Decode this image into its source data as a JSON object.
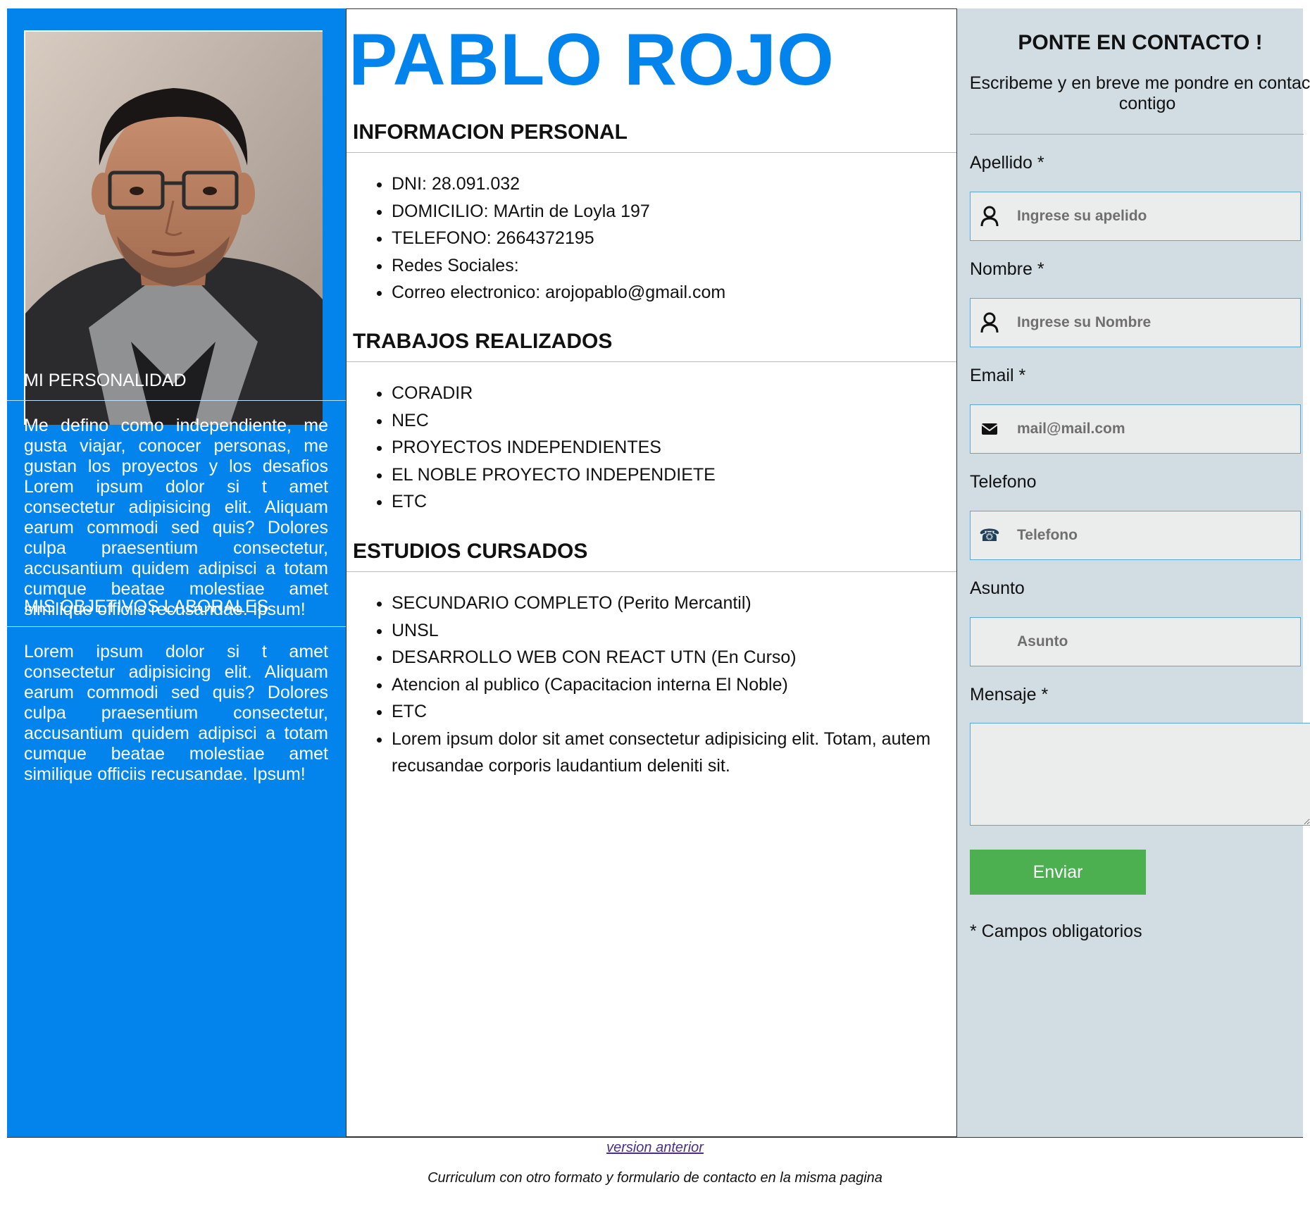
{
  "profile": {
    "photo_alt": "",
    "personality_heading": "MI PERSONALIDAD",
    "personality_text": "Me defino como independiente, me gusta viajar, conocer personas, me gustan los proyectos y los desafios Lorem ipsum dolor si t amet consectetur adipisicing elit. Aliquam earum commodi sed quis? Dolores culpa praesentium consectetur, accusantium quidem adipisci a totam cumque beatae molestiae amet similique officiis recusandae. Ipsum!",
    "objectives_heading": "MIS OBJETIVOS LABORALES",
    "objectives_text": "Lorem ipsum dolor si t amet consectetur adipisicing elit. Aliquam earum commodi sed quis? Dolores culpa praesentium consectetur, accusantium quidem adipisci a totam cumque beatae molestiae amet similique officiis recusandae. Ipsum!"
  },
  "main": {
    "name": "PABLO ROJO",
    "personal_info": {
      "title": "INFORMACION PERSONAL",
      "items": [
        "DNI: 28.091.032",
        "DOMICILIO: MArtin de Loyla 197",
        "TELEFONO: 2664372195",
        "Redes Sociales:",
        "Correo electronico: arojopablo@gmail.com"
      ]
    },
    "jobs": {
      "title": "TRABAJOS REALIZADOS",
      "items": [
        "CORADIR",
        "NEC",
        "PROYECTOS INDEPENDIENTES",
        "EL NOBLE PROYECTO INDEPENDIETE",
        "ETC"
      ]
    },
    "studies": {
      "title": "ESTUDIOS CURSADOS",
      "items": [
        "SECUNDARIO COMPLETO (Perito Mercantil)",
        "UNSL",
        "DESARROLLO WEB CON REACT UTN (En Curso)",
        "Atencion al publico (Capacitacion interna El Noble)",
        "ETC",
        "Lorem ipsum dolor sit amet consectetur adipisicing elit. Totam, autem recusandae corporis laudantium deleniti sit."
      ]
    }
  },
  "contact": {
    "title": "PONTE EN CONTACTO !",
    "subtitle": "Escribeme y en breve me pondre en contacto contigo",
    "fields": {
      "apellido": {
        "label": "Apellido *",
        "placeholder": "Ingrese su apelido",
        "value": "",
        "icon": "user-icon"
      },
      "nombre": {
        "label": "Nombre *",
        "placeholder": "Ingrese su Nombre",
        "value": "",
        "icon": "user-icon"
      },
      "email": {
        "label": "Email *",
        "placeholder": "mail@mail.com",
        "value": "",
        "icon": "envelope-icon"
      },
      "telefono": {
        "label": "Telefono",
        "placeholder": "Telefono",
        "value": "",
        "icon": "phone-icon"
      },
      "asunto": {
        "label": "Asunto",
        "placeholder": "Asunto",
        "value": ""
      },
      "mensaje": {
        "label": "Mensaje *",
        "value": ""
      }
    },
    "submit_label": "Enviar",
    "required_note": "* Campos obligatorios"
  },
  "footer": {
    "link_text": "version anterior",
    "text": "Curriculum con otro formato y formulario de contacto en la misma pagina"
  },
  "colors": {
    "primary_blue": "#0284ec",
    "contact_bg": "#d1dce3",
    "submit_green": "#4caf50"
  }
}
